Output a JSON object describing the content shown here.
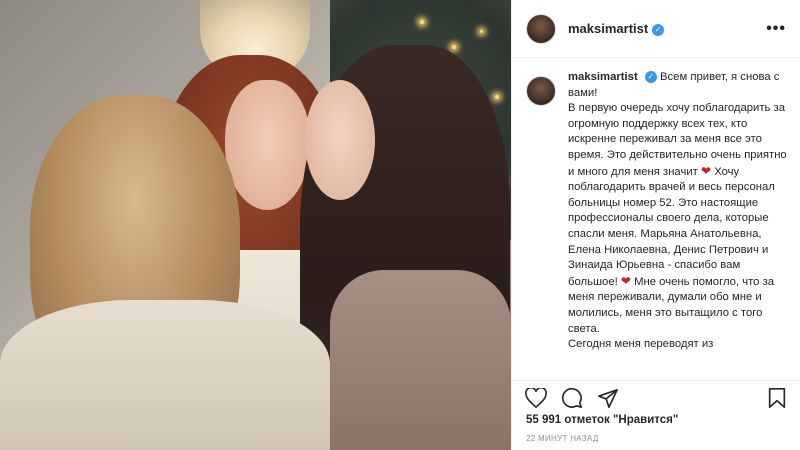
{
  "post": {
    "username": "maksimartist",
    "verified_icon": "verified-badge-icon",
    "more_icon": "more-options-icon"
  },
  "caption": {
    "username": "maksimartist",
    "segments": [
      "Всем привет, я снова с вами!",
      "В первую очередь хочу поблагодарить за огромную поддержку всех тех, кто искренне переживал за меня все это время. Это действительно очень приятно и много для меня значит",
      "Хочу поблагодарить врачей и весь персонал больницы номер 52. Это настоящие профессионалы своего дела, которые спасли меня. Марьяна Анатольевна, Елена Николаевна, Денис Петрович и Зинаида Юрьевна - спасибо вам большое!",
      "Мне очень помогло, что за меня переживали, думали обо мне и молились, меня это вытащило с того света.",
      "Сегодня меня переводят из"
    ],
    "heart_glyph": "❤"
  },
  "actions": {
    "like_icon": "heart-icon",
    "comment_icon": "comment-icon",
    "share_icon": "share-icon",
    "save_icon": "bookmark-icon"
  },
  "likes_text": "55 991 отметок \"Нравится\"",
  "timestamp": "22 МИНУТ НАЗАД",
  "colors": {
    "verified": "#3897f0",
    "heart": "#c8232c",
    "text": "#262626",
    "muted": "#8e8e8e"
  }
}
